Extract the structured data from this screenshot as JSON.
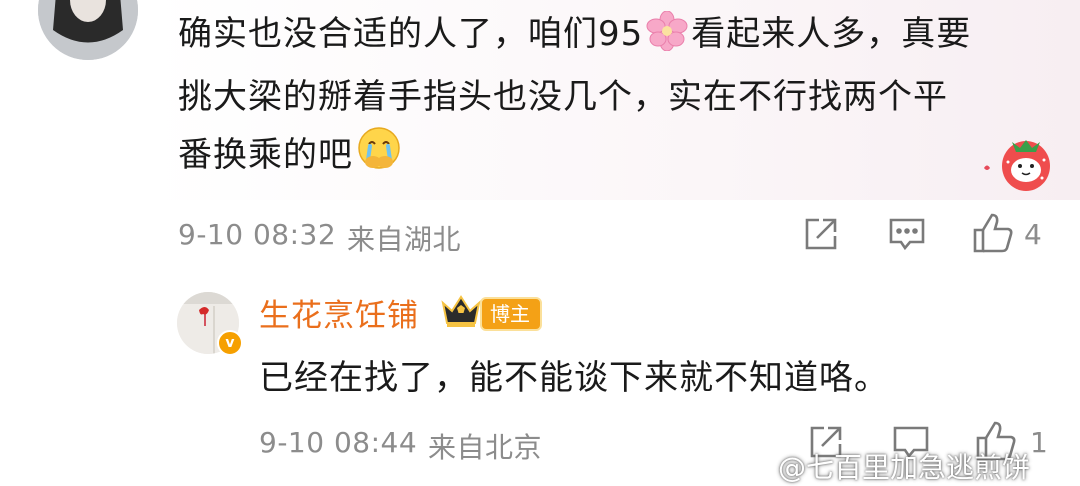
{
  "comment": {
    "text_line1_a": "确实也没合适的人了，咱们95",
    "text_line1_b": "看起来人多，真要",
    "text_line2": "挑大梁的掰着手指头也没几个，实在不行找两个平",
    "text_line3": "番换乘的吧",
    "emoji_flower": "flower-emoji",
    "emoji_cry": "crying-face-emoji",
    "time": "9-10 08:32",
    "location": "来自湖北",
    "likes": "4"
  },
  "reply": {
    "author": "生花烹饪铺",
    "badge": "博主",
    "text": "已经在找了，能不能谈下来就不知道咯。",
    "time": "9-10 08:44",
    "location": "来自北京",
    "likes": "1"
  },
  "watermark": {
    "text": "@七百里加急逃煎饼"
  },
  "colors": {
    "author": "#ea6f1c",
    "meta": "#8c8c8c",
    "badge": "#f4a116"
  }
}
